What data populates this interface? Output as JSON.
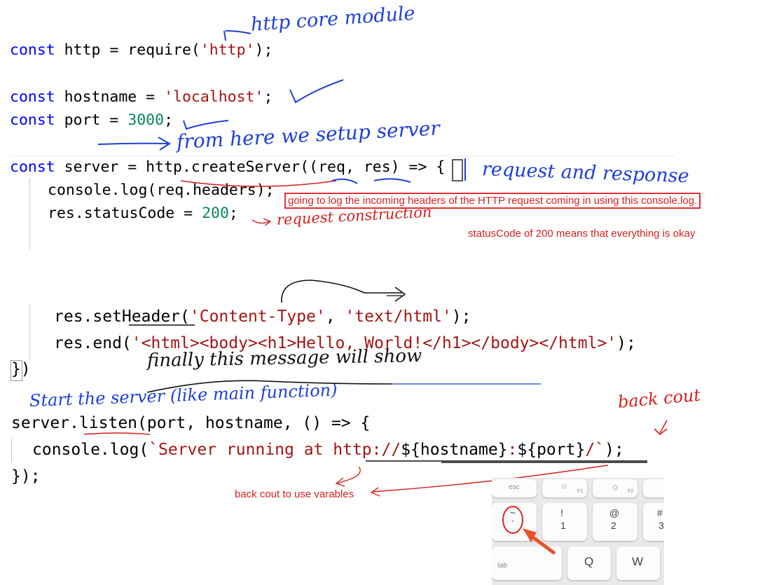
{
  "code_block_1": {
    "line1": {
      "kw": "const",
      "text_a": " http = require(",
      "str": "'http'",
      "text_b": ");"
    },
    "line2": {
      "kw": "const",
      "text_a": " hostname = ",
      "str": "'localhost'",
      "text_b": ";"
    },
    "line3": {
      "kw": "const",
      "text_a": " port = ",
      "num": "3000",
      "text_b": ";"
    },
    "line4": {
      "kw": "const",
      "text_a": " server = http.createServer((req, res) => {"
    },
    "line5": {
      "text": "console.log(req.headers);"
    },
    "line6": {
      "text_a": "res.statusCode = ",
      "num": "200",
      "text_b": ";"
    }
  },
  "code_block_2": {
    "line1": {
      "text_a": "res.setHeader(",
      "str1": "'Content-Type'",
      "text_b": ", ",
      "str2": "'text/html'",
      "text_c": ");"
    },
    "line2": {
      "text_a": "res.end(",
      "str": "'<html><body><h1>Hello, World!</h1></body></html>'",
      "text_b": ");"
    },
    "line3": {
      "text": "})"
    }
  },
  "code_block_3": {
    "line1": {
      "text": "server.listen(port, hostname, () => {"
    },
    "line2": {
      "text_a": "console.log(",
      "str": "`Server running at http://",
      "text_b": "${hostname}",
      "str2": ":",
      "text_c": "${port}",
      "str3": "/`",
      "text_d": ");"
    },
    "line3": {
      "text": "});"
    }
  },
  "handwritten": {
    "http_core_module": "http core module",
    "from_here": "from here we setup server",
    "request_and_response": "request and response",
    "request_construction": "request construction",
    "finally_message": "finally this message will show",
    "start_server": "Start the server (like main function)",
    "back_cout": "back cout"
  },
  "notes": {
    "headers_note": "going to log the incoming headers of the HTTP request coming in using this console.log.",
    "status_note": "statusCode of 200 means that everything is okay",
    "backcout_note": "back cout to use varables"
  },
  "keyboard": {
    "keys": {
      "esc": "esc",
      "f1": "F1",
      "f2": "F2",
      "tilde_top": "~",
      "tilde_bottom": "`",
      "excl": "!",
      "one": "1",
      "at": "@",
      "two": "2",
      "hash": "#",
      "three": "3",
      "tab": "tab",
      "q": "Q",
      "w": "W"
    }
  },
  "colors": {
    "keyword": "#0000ff",
    "string": "#a31515",
    "number": "#098658",
    "annotation_blue": "#1f3fd6",
    "annotation_red": "#d42020"
  }
}
